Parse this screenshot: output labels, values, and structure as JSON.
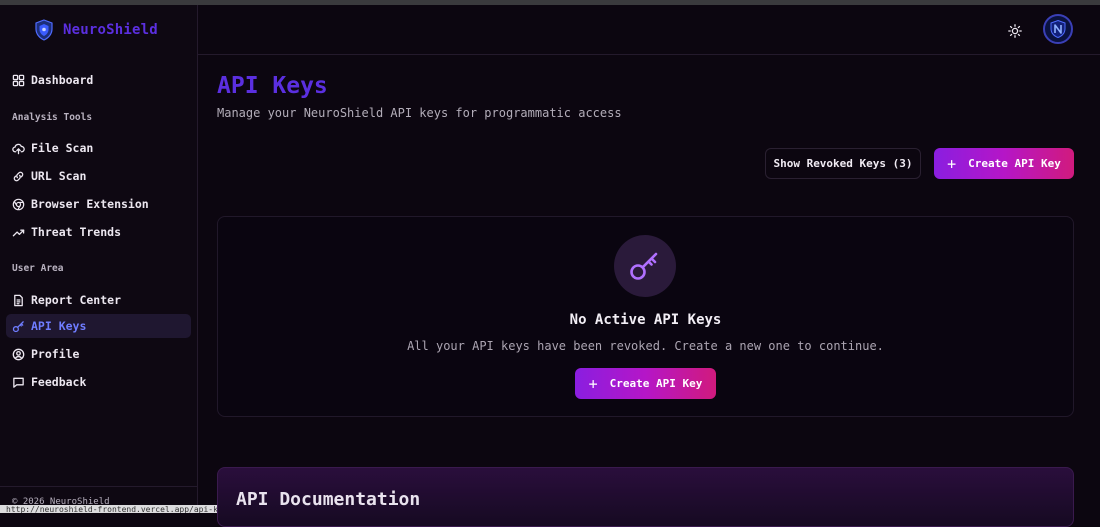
{
  "app": {
    "name": "NeuroShield"
  },
  "sidebar": {
    "dashboard": "Dashboard",
    "section_analysis": "Analysis Tools",
    "analysis_items": [
      {
        "label": "File Scan",
        "icon": "cloud-upload-icon"
      },
      {
        "label": "URL Scan",
        "icon": "link-icon"
      },
      {
        "label": "Browser Extension",
        "icon": "chrome-icon"
      },
      {
        "label": "Threat Trends",
        "icon": "trending-up-icon"
      }
    ],
    "section_user": "User Area",
    "user_items": [
      {
        "label": "Report Center",
        "icon": "file-text-icon"
      },
      {
        "label": "API Keys",
        "icon": "key-icon",
        "active": true
      },
      {
        "label": "Profile",
        "icon": "user-circle-icon"
      },
      {
        "label": "Feedback",
        "icon": "message-square-icon"
      }
    ],
    "copyright": "© 2026 NeuroShield"
  },
  "status_bar": {
    "url": "http://neuroshield-frontend.vercel.app/api-keys"
  },
  "page": {
    "title": "API Keys",
    "subtitle": "Manage your NeuroShield API keys for programmatic access"
  },
  "actions": {
    "show_revoked": "Show Revoked Keys (3)",
    "create": "Create API Key"
  },
  "empty_state": {
    "title": "No Active API Keys",
    "description": "All your API keys have been revoked. Create a new one to continue.",
    "button": "Create API Key"
  },
  "docs": {
    "title": "API Documentation"
  },
  "colors": {
    "accent": "#5b2fe0",
    "active_nav": "#6f7dff",
    "gradient_start": "#8a1ee0",
    "gradient_end": "#d11a7d",
    "background": "#0c0610"
  }
}
